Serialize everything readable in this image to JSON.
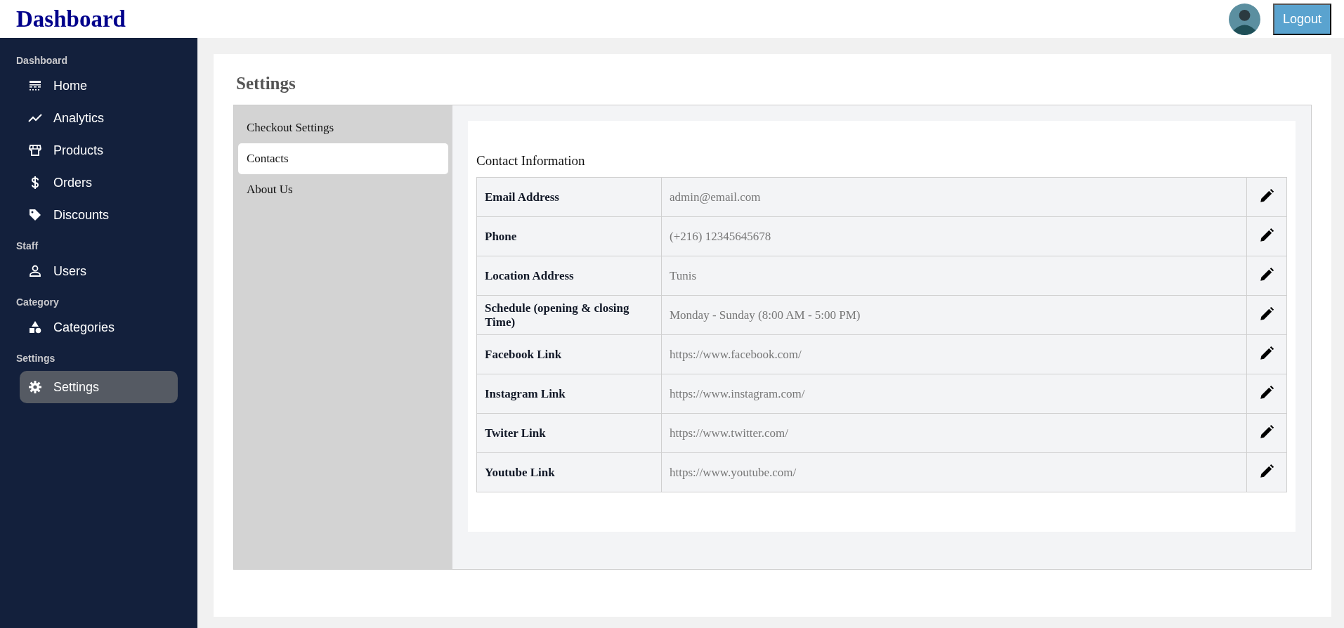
{
  "header": {
    "title": "Dashboard",
    "logout_label": "Logout"
  },
  "sidebar": {
    "sections": [
      {
        "label": "Dashboard",
        "items": [
          {
            "label": "Home",
            "kind": "home",
            "selected": false
          },
          {
            "label": "Analytics",
            "kind": "analytics",
            "selected": false
          },
          {
            "label": "Products",
            "kind": "store",
            "selected": false
          },
          {
            "label": "Orders",
            "kind": "dollar",
            "selected": false
          },
          {
            "label": "Discounts",
            "kind": "tag",
            "selected": false
          }
        ]
      },
      {
        "label": "Staff",
        "items": [
          {
            "label": "Users",
            "kind": "user",
            "selected": false
          }
        ]
      },
      {
        "label": "Category",
        "items": [
          {
            "label": "Categories",
            "kind": "shapes",
            "selected": false
          }
        ]
      },
      {
        "label": "Settings",
        "items": [
          {
            "label": "Settings",
            "kind": "gear",
            "selected": true
          }
        ]
      }
    ]
  },
  "page": {
    "title": "Settings",
    "tabs": [
      {
        "label": "Checkout Settings",
        "selected": false
      },
      {
        "label": "Contacts",
        "selected": true
      },
      {
        "label": "About Us",
        "selected": false
      }
    ],
    "section_title": "Contact Information",
    "rows": [
      {
        "label": "Email Address",
        "value": "admin@email.com"
      },
      {
        "label": "Phone",
        "value": "(+216) 12345645678"
      },
      {
        "label": "Location Address",
        "value": "Tunis"
      },
      {
        "label": "Schedule (opening & closing Time)",
        "value": "Monday - Sunday (8:00 AM - 5:00 PM)"
      },
      {
        "label": "Facebook Link",
        "value": "https://www.facebook.com/"
      },
      {
        "label": "Instagram Link",
        "value": "https://www.instagram.com/"
      },
      {
        "label": "Twiter Link",
        "value": "https://www.twitter.com/"
      },
      {
        "label": "Youtube Link",
        "value": "https://www.youtube.com/"
      }
    ]
  }
}
